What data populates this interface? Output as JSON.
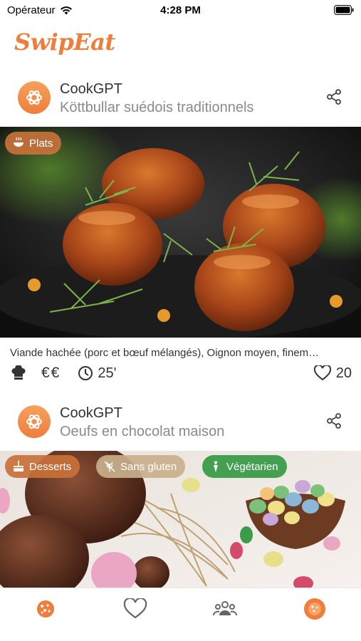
{
  "status_bar": {
    "carrier": "Opérateur",
    "time": "4:28 PM"
  },
  "app": {
    "logo": "SwipEat"
  },
  "cards": [
    {
      "author": "CookGPT",
      "title": "Köttbullar suédois traditionnels",
      "tags": [
        {
          "label": "Plats",
          "icon": "bowl-icon",
          "color": "#c8713a"
        }
      ],
      "ingredients": "Viande hachée (porc et bœuf mélangés), Oignon moyen, finem…",
      "price": "€€",
      "time": "25'",
      "likes": "20"
    },
    {
      "author": "CookGPT",
      "title": "Oeufs en chocolat maison",
      "tags": [
        {
          "label": "Desserts",
          "icon": "cake-icon",
          "color": "#c8713a"
        },
        {
          "label": "Sans gluten",
          "icon": "wheat-off-icon",
          "color": "#c9b08c"
        },
        {
          "label": "Végétarien",
          "icon": "carrot-icon",
          "color": "#3a9b48"
        }
      ]
    }
  ],
  "tabs": [
    {
      "name": "cookie-icon",
      "active": true
    },
    {
      "name": "heart-icon",
      "active": false
    },
    {
      "name": "community-icon",
      "active": false
    },
    {
      "name": "profile-cookie-icon",
      "active": false
    }
  ],
  "colors": {
    "brand": "#ef7d3c",
    "tab_active": "#ef7d3c",
    "tab_inactive": "#666666"
  }
}
